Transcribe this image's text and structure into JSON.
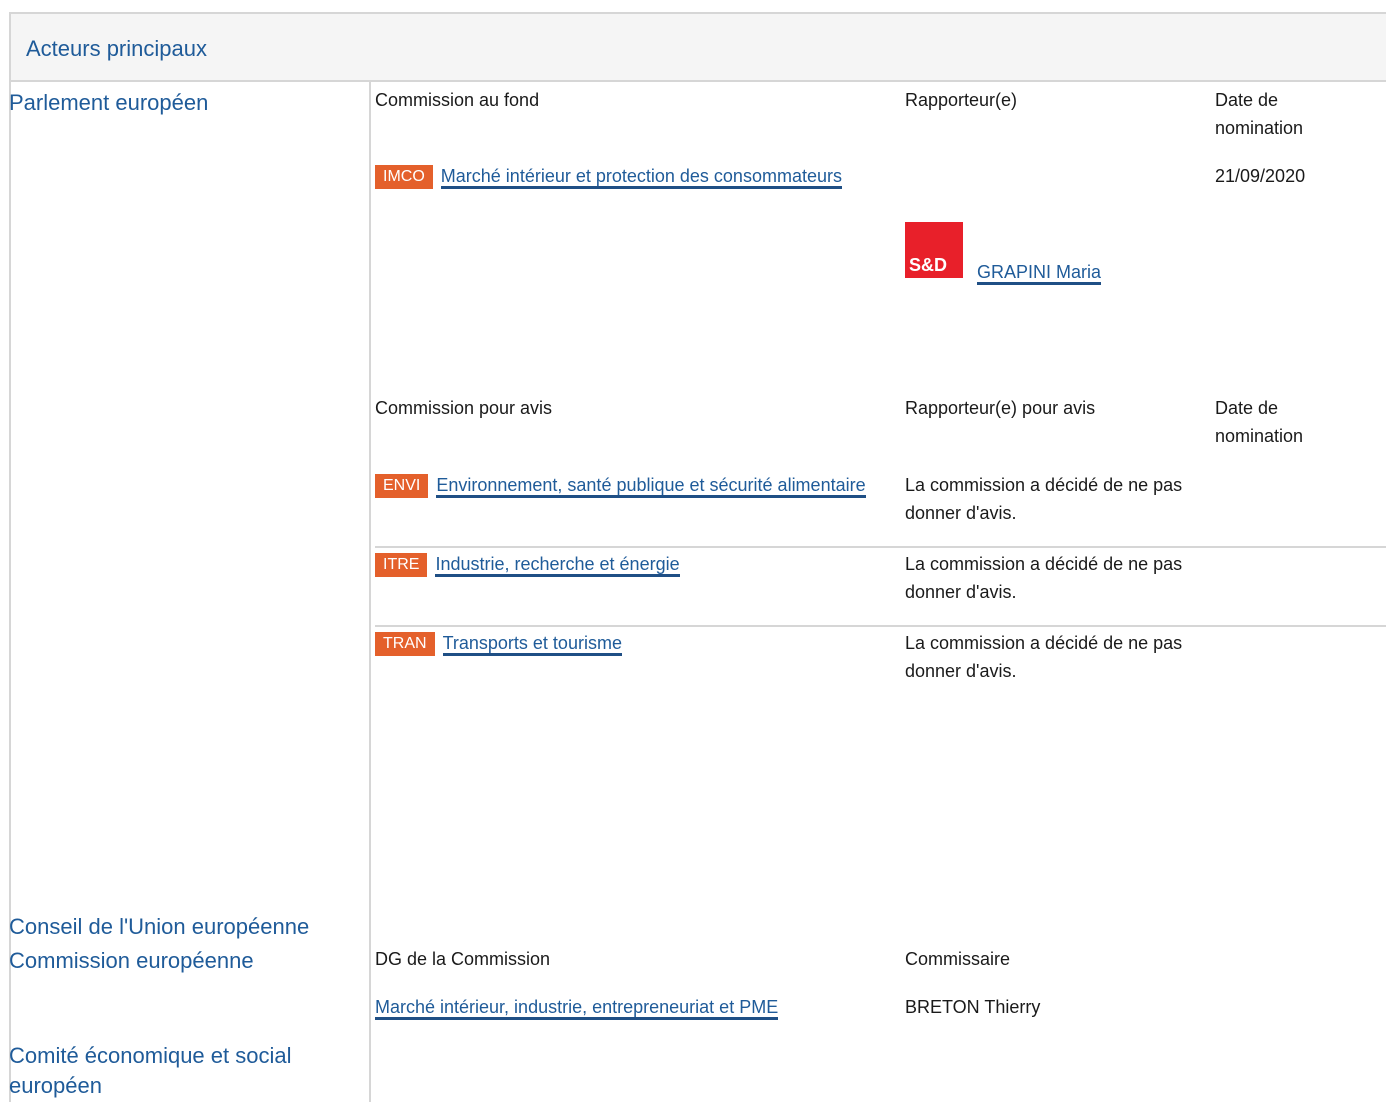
{
  "section_title": "Acteurs principaux",
  "actors": {
    "parliament": "Parlement européen",
    "council": "Conseil de l'Union européenne",
    "commission": "Commission européenne",
    "eesc": "Comité économique et social européen"
  },
  "lead_committee": {
    "col_committee": "Commission au fond",
    "col_rapporteur": "Rapporteur(e)",
    "col_date": "Date de nomination",
    "code": "IMCO",
    "name": "Marché intérieur et protection des consommateurs",
    "group_logo": "S&D",
    "rapporteur": "GRAPINI Maria",
    "date": "21/09/2020"
  },
  "opinion_committees": {
    "col_committee": "Commission pour avis",
    "col_rapporteur": "Rapporteur(e) pour avis",
    "col_date": "Date de nomination",
    "rows": [
      {
        "code": "ENVI",
        "name": "Environnement, santé publique et sécurité alimentaire",
        "status": "La commission a décidé de ne pas donner d'avis."
      },
      {
        "code": "ITRE",
        "name": "Industrie, recherche et énergie",
        "status": "La commission a décidé de ne pas donner d'avis."
      },
      {
        "code": "TRAN",
        "name": "Transports et tourisme",
        "status": "La commission a décidé de ne pas donner d'avis."
      }
    ]
  },
  "commission_info": {
    "col_dg": "DG de la Commission",
    "col_commissioner": "Commissaire",
    "dg": "Marché intérieur, industrie, entrepreneuriat et PME",
    "commissioner": "BRETON Thierry"
  },
  "colors": {
    "accent": "#1f5b99",
    "badge": "#e4602b",
    "sd_red": "#e8202a",
    "border": "#d6d6d6"
  }
}
